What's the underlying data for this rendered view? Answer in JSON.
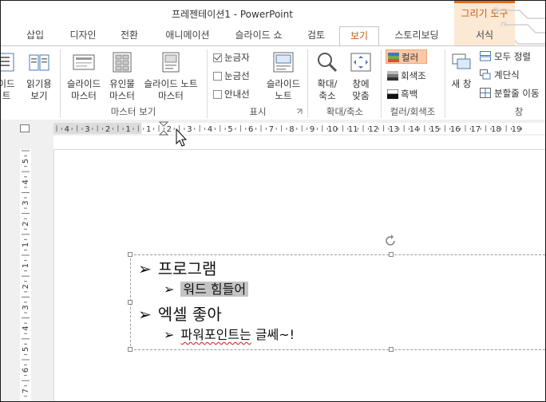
{
  "window": {
    "title": "프레젠테이션1 - PowerPoint",
    "context_header": "그리기 도구"
  },
  "tabs": [
    {
      "label": "삽입"
    },
    {
      "label": "디자인"
    },
    {
      "label": "전환"
    },
    {
      "label": "애니메이션"
    },
    {
      "label": "슬라이드 쇼"
    },
    {
      "label": "검토"
    },
    {
      "label": "보기",
      "active": true
    },
    {
      "label": "스토리보딩"
    },
    {
      "label": "서식",
      "context": true
    }
  ],
  "ribbon": {
    "presentation_views": {
      "outline_label": [
        "이드",
        "트"
      ],
      "reading_label": [
        "읽기용",
        "보기"
      ]
    },
    "master_views": {
      "group": "마스터 보기",
      "slide_master": [
        "슬라이드",
        "마스터"
      ],
      "handout_master": [
        "유인물",
        "마스터"
      ],
      "notes_master": [
        "슬라이드 노트",
        "마스터"
      ]
    },
    "show": {
      "group": "표시",
      "ruler": "눈금자",
      "ruler_checked": true,
      "gridlines": "눈금선",
      "gridlines_checked": false,
      "guides": "안내선",
      "guides_checked": false,
      "notes": [
        "슬라이드",
        "노트"
      ]
    },
    "zoom": {
      "group": "확대/축소",
      "zoom": [
        "확대/",
        "축소"
      ],
      "fit": [
        "창에",
        "맞춤"
      ]
    },
    "color": {
      "group": "컬러/회색조",
      "color": "컬러",
      "grayscale": "회색조",
      "bw": "흑백"
    },
    "window": {
      "group": "창",
      "new_window": "새 창",
      "arrange_all": "모두 정렬",
      "cascade": "계단식",
      "split": "분할줄 이동"
    }
  },
  "ruler": {
    "h_labels": [
      "4",
      "3",
      "2",
      "1",
      "1",
      "2",
      "3",
      "4",
      "5",
      "6",
      "7",
      "8",
      "9",
      "10",
      "11",
      "12",
      "13",
      "14",
      "15",
      "16",
      "17",
      "18",
      "19"
    ],
    "v_labels": [
      "5",
      "4",
      "3",
      "2",
      "1",
      "1",
      "2",
      "3",
      "4",
      "5",
      "6",
      "7"
    ]
  },
  "slide": {
    "bullets": [
      {
        "level": 1,
        "text": "프로그램"
      },
      {
        "level": 2,
        "text": "워드 힘들어",
        "selected": true
      },
      {
        "level": 1,
        "text": "엑셀 좋아"
      },
      {
        "level": 2,
        "text": "파워포인트는 글쎄~!",
        "spell_error": "파워포인트는"
      }
    ],
    "bullet_glyph": "➢"
  }
}
